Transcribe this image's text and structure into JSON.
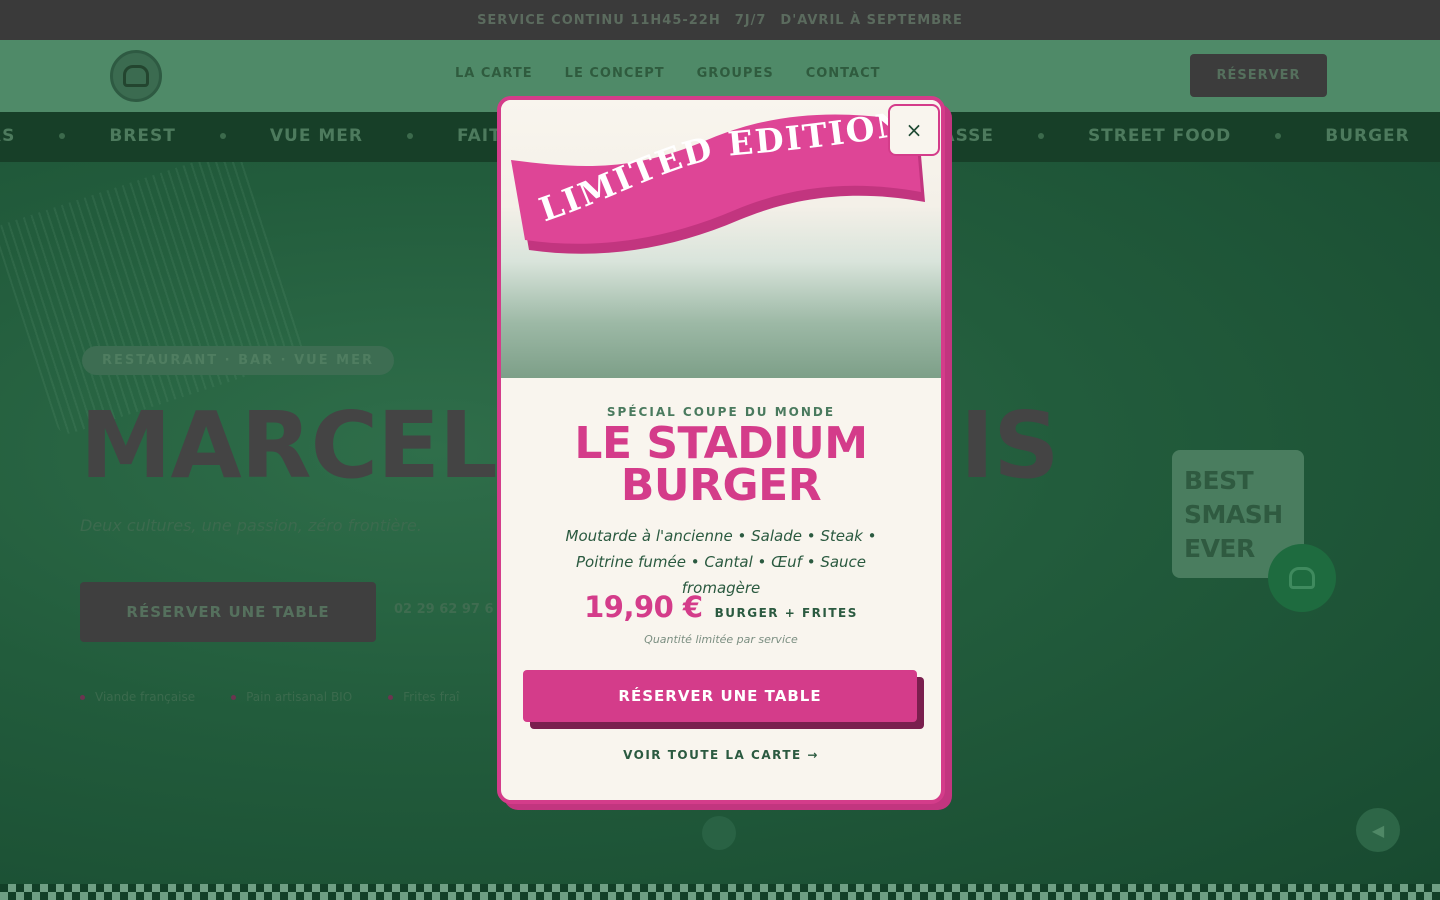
{
  "topbar": {
    "items": [
      "SERVICE CONTINU 11H45-22H",
      "7J/7",
      "D'AVRIL À SEPTEMBRE"
    ]
  },
  "header": {
    "nav": [
      "LA CARTE",
      "LE CONCEPT",
      "GROUPES",
      "CONTACT"
    ],
    "reserve_label": "RÉSERVER"
  },
  "ticker": {
    "items": [
      "RS",
      "BREST",
      "VUE MER",
      "FAIT MAI",
      "TERRASSE",
      "STREET FOOD",
      "BURGER"
    ]
  },
  "hero": {
    "chip": "RESTAURANT · BAR · VUE MER",
    "title_left": "MARCELL",
    "title_right": "IS",
    "subtitle": "Deux cultures, une passion, zéro frontière.",
    "cta_label": "RÉSERVER UNE TABLE",
    "phone": "02 29 62 97 6",
    "features": [
      "Viande française",
      "Pain artisanal BIO",
      "Frites fraî"
    ],
    "badge_lines": [
      "BEST",
      "SMASH",
      "EVER"
    ]
  },
  "modal": {
    "ribbon_text": "LIMITED EDITION",
    "close_label": "×",
    "eyebrow": "SPÉCIAL COUPE DU MONDE",
    "title_line1": "LE STADIUM",
    "title_line2": "BURGER",
    "description": "Moutarde à l'ancienne • Salade • Steak • Poitrine fumée • Cantal • Œuf • Sauce fromagère",
    "price": "19,90 €",
    "price_suffix": "BURGER + FRITES",
    "note": "Quantité limitée par service",
    "cta_label": "RÉSERVER UNE TABLE",
    "link_label": "VOIR TOUTE LA CARTE →"
  },
  "colors": {
    "accent_pink": "#d43c8a",
    "dark_green": "#1f4a33",
    "cream": "#f9f5ee"
  }
}
